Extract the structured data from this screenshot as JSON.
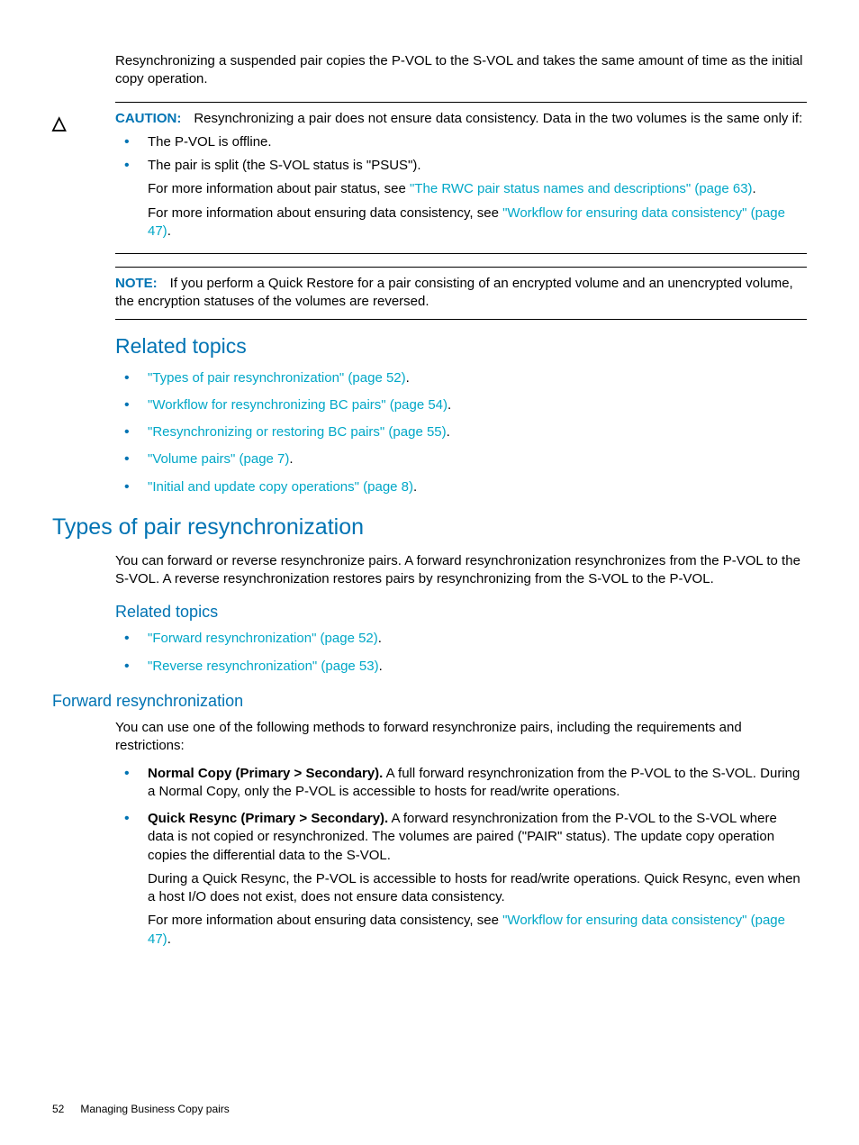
{
  "intro": "Resynchronizing a suspended pair copies the P-VOL to the S-VOL and takes the same amount of time as the initial copy operation.",
  "caution": {
    "label": "CAUTION:",
    "lead": "Resynchronizing a pair does not ensure data consistency. Data in the two volumes is the same only if:",
    "items": {
      "b1": "The P-VOL is offline.",
      "b2": "The pair is split (the S-VOL status is \"PSUS\").",
      "b2_sub1_pre": "For more information about pair status, see ",
      "b2_sub1_link": "\"The RWC pair status names and descriptions\" (page 63)",
      "b2_sub1_post": ".",
      "b2_sub2_pre": "For more information about ensuring data consistency, see ",
      "b2_sub2_link": "\"Workflow for ensuring data consistency\" (page 47)",
      "b2_sub2_post": "."
    }
  },
  "note": {
    "label": "NOTE:",
    "text": "If you perform a Quick Restore for a pair consisting of an encrypted volume and an unencrypted volume, the encryption statuses of the volumes are reversed."
  },
  "related1": {
    "heading": "Related topics",
    "items": {
      "i1": "\"Types of pair resynchronization\" (page 52)",
      "i2": "\"Workflow for resynchronizing BC pairs\" (page 54)",
      "i3": "\"Resynchronizing or restoring BC pairs\" (page 55)",
      "i4": "\"Volume pairs\" (page 7)",
      "i5": "\"Initial and update copy operations\" (page 8)"
    },
    "dot": "."
  },
  "sec2": {
    "heading": "Types of pair resynchronization",
    "para": "You can forward or reverse resynchronize pairs. A forward resynchronization resynchronizes from the P-VOL to the S-VOL. A reverse resynchronization restores pairs by resynchronizing from the S-VOL to the P-VOL.",
    "related_heading": "Related topics",
    "items": {
      "i1": "\"Forward resynchronization\" (page 52)",
      "i2": "\"Reverse resynchronization\" (page 53)"
    },
    "dot": "."
  },
  "sec3": {
    "heading": "Forward resynchronization",
    "para": "You can use one of the following methods to forward resynchronize pairs, including the requirements and restrictions:",
    "b1_bold": "Normal Copy (Primary > Secondary).",
    "b1_text": " A full forward resynchronization from the P-VOL to the S-VOL. During a Normal Copy, only the P-VOL is accessible to hosts for read/write operations.",
    "b2_bold": "Quick Resync (Primary > Secondary).",
    "b2_text": " A forward resynchronization from the P-VOL to the S-VOL where data is not copied or resynchronized. The volumes are paired (\"PAIR\" status). The update copy operation copies the differential data to the S-VOL.",
    "b2_p2": "During a Quick Resync, the P-VOL is accessible to hosts for read/write operations. Quick Resync, even when a host I/O does not exist, does not ensure data consistency.",
    "b2_p3_pre": "For more information about ensuring data consistency, see ",
    "b2_p3_link": "\"Workflow for ensuring data consistency\" (page 47)",
    "b2_p3_post": "."
  },
  "footer": {
    "page": "52",
    "title": "Managing Business Copy pairs"
  },
  "icons": {
    "caution": "△"
  }
}
